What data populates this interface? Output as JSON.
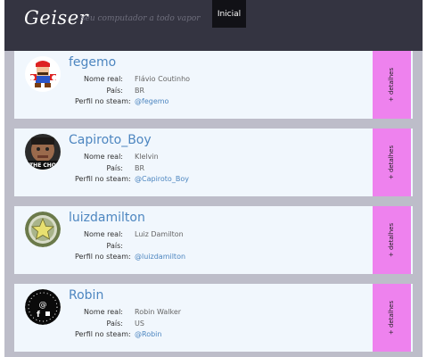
{
  "header": {
    "brand": "Geiser",
    "tagline": "- seu computador a todo vapor",
    "nav_home": "Inicial"
  },
  "labels": {
    "real_name": "Nome real:",
    "country": "País:",
    "steam_profile": "Perfil no steam:",
    "details": "+ detalhes"
  },
  "users": [
    {
      "username": "fegemo",
      "real_name": "Flávio Coutinho",
      "country": "BR",
      "steam": "@fegemo"
    },
    {
      "username": "Capiroto_Boy",
      "real_name": "Klelvin",
      "country": "BR",
      "steam": "@Capiroto_Boy"
    },
    {
      "username": "luizdamilton",
      "real_name": "Luiz Damilton",
      "country": "",
      "steam": "@luizdamilton"
    },
    {
      "username": "Robin",
      "real_name": "Robin Walker",
      "country": "US",
      "steam": "@Robin"
    }
  ]
}
